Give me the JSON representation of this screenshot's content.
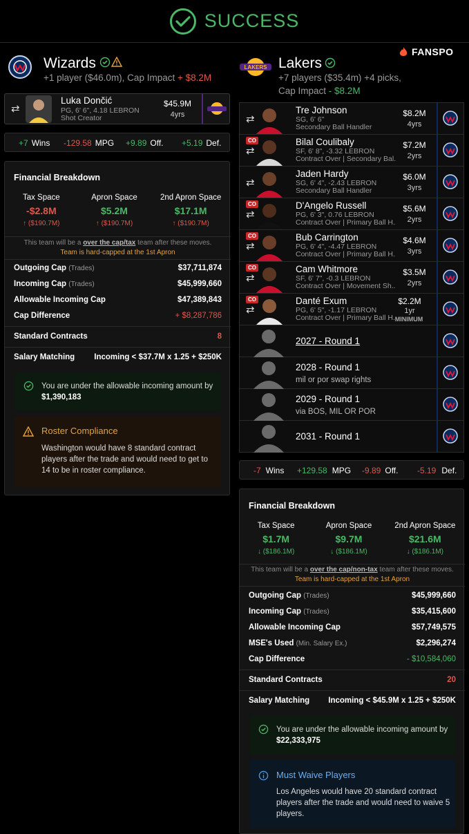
{
  "header": {
    "title": "SUCCESS"
  },
  "brand": {
    "name": "FANSPO"
  },
  "wizards": {
    "name": "Wizards",
    "summary": "+1 player ($46.0m), Cap Impact",
    "cap_impact": "+ $8.2M",
    "player": {
      "name": "Luka Dončić",
      "meta1": "PG, 6' 6\", 4.18 LEBRON",
      "meta2": "Shot Creator",
      "salary": "$45.9M",
      "years": "4yrs"
    },
    "stats": {
      "wins": "+7",
      "wins_label": "Wins",
      "mpg": "-129.58",
      "mpg_label": "MPG",
      "off": "+9.89",
      "off_label": "Off.",
      "def": "+5.19",
      "def_label": "Def."
    },
    "fb": {
      "title": "Financial Breakdown",
      "cols": [
        {
          "h": "Tax Space",
          "v": "-$2.8M",
          "d": "($190.7M)"
        },
        {
          "h": "Apron Space",
          "v": "$5.2M",
          "d": "($190.7M)"
        },
        {
          "h": "2nd Apron Space",
          "v": "$17.1M",
          "d": "($190.7M)"
        }
      ],
      "note_pre": "This team will be a",
      "note_link": "over the cap/tax",
      "note_post": "team after these moves.",
      "hard": "Team is hard-capped at the 1st Apron",
      "outgoing_label": "Outgoing Cap",
      "outgoing_sub": "(Trades)",
      "outgoing": "$37,711,874",
      "incoming_label": "Incoming Cap",
      "incoming_sub": "(Trades)",
      "incoming": "$45,999,660",
      "allow_label": "Allowable Incoming Cap",
      "allow": "$47,389,843",
      "diff_label": "Cap Difference",
      "diff": "+ $8,287,786",
      "std_label": "Standard Contracts",
      "std": "8",
      "sal_label": "Salary Matching",
      "sal": "Incoming < $37.7M x 1.25 + $250K",
      "ok_text": "You are under the allowable incoming amount by",
      "ok_amount": "$1,390,183",
      "warn_title": "Roster Compliance",
      "warn_text": "Washington would have 8 standard contract players after the trade and would need to get to 14 to be in roster compliance."
    }
  },
  "lakers": {
    "name": "Lakers",
    "summary": "+7 players ($35.4m) +4 picks,",
    "cap_label": "Cap Impact",
    "cap_impact": "- $8.2M",
    "players": [
      {
        "name": "Tre Johnson",
        "meta1": "SG, 6' 6\"",
        "meta2": "Secondary Ball Handler",
        "salary": "$8.2M",
        "years": "4yrs",
        "co": false
      },
      {
        "name": "Bilal Coulibaly",
        "meta1": "SF, 6' 8\", -3.32 LEBRON",
        "meta2": "Contract Over | Secondary Bal...",
        "salary": "$7.2M",
        "years": "2yrs",
        "co": true
      },
      {
        "name": "Jaden Hardy",
        "meta1": "SG, 6' 4\", -2.43 LEBRON",
        "meta2": "Secondary Ball Handler",
        "salary": "$6.0M",
        "years": "3yrs",
        "co": false
      },
      {
        "name": "D'Angelo Russell",
        "meta1": "PG, 6' 3\", 0.76 LEBRON",
        "meta2": "Contract Over | Primary Ball H...",
        "salary": "$5.6M",
        "years": "2yrs",
        "co": true
      },
      {
        "name": "Bub Carrington",
        "meta1": "PG, 6' 4\", -4.47 LEBRON",
        "meta2": "Contract Over | Primary Ball H...",
        "salary": "$4.6M",
        "years": "3yrs",
        "co": true
      },
      {
        "name": "Cam Whitmore",
        "meta1": "SF, 6' 7\", -0.3 LEBRON",
        "meta2": "Contract Over | Movement Sh...",
        "salary": "$3.5M",
        "years": "2yrs",
        "co": true
      },
      {
        "name": "Danté Exum",
        "meta1": "PG, 6' 5\", -1.17 LEBRON",
        "meta2": "Contract Over | Primary Ball H...",
        "salary": "$2.2M",
        "years": "1yr",
        "extra": "MINIMUM",
        "co": true
      }
    ],
    "picks": [
      {
        "title": "2027 - Round 1",
        "sub": ""
      },
      {
        "title": "2028 - Round 1",
        "sub": "mil or por swap rights"
      },
      {
        "title": "2029 - Round 1",
        "sub": "via BOS, MIL OR POR"
      },
      {
        "title": "2031 - Round 1",
        "sub": ""
      }
    ],
    "co_label": "CO",
    "stats": {
      "wins": "-7",
      "wins_label": "Wins",
      "mpg": "+129.58",
      "mpg_label": "MPG",
      "off": "-9.89",
      "off_label": "Off.",
      "def": "-5.19",
      "def_label": "Def."
    },
    "fb": {
      "title": "Financial Breakdown",
      "cols": [
        {
          "h": "Tax Space",
          "v": "$1.7M",
          "d": "($186.1M)"
        },
        {
          "h": "Apron Space",
          "v": "$9.7M",
          "d": "($186.1M)"
        },
        {
          "h": "2nd Apron Space",
          "v": "$21.6M",
          "d": "($186.1M)"
        }
      ],
      "note_pre": "This team will be a",
      "note_link": "over the cap/non-tax",
      "note_post": "team after these moves.",
      "hard": "Team is hard-capped at the 1st Apron",
      "outgoing_label": "Outgoing Cap",
      "outgoing_sub": "(Trades)",
      "outgoing": "$45,999,660",
      "incoming_label": "Incoming Cap",
      "incoming_sub": "(Trades)",
      "incoming": "$35,415,600",
      "allow_label": "Allowable Incoming Cap",
      "allow": "$57,749,575",
      "mse_label": "MSE's Used",
      "mse_sub": "(Min. Salary Ex.)",
      "mse": "$2,296,274",
      "diff_label": "Cap Difference",
      "diff": "- $10,584,060",
      "std_label": "Standard Contracts",
      "std": "20",
      "sal_label": "Salary Matching",
      "sal": "Incoming < $45.9M x 1.25 + $250K",
      "ok_text": "You are under the allowable incoming amount by",
      "ok_amount": "$22,333,975",
      "info_title": "Must Waive Players",
      "info_text": "Los Angeles would have 20 standard contract players after the trade and would need to waive 5 players."
    }
  },
  "colors": {
    "green": "#4ab866",
    "red": "#e0564a",
    "orange": "#e6a23c",
    "wizards_blue": "#0b2a5e",
    "lakers_purple": "#552583",
    "lakers_gold": "#fdb927"
  }
}
